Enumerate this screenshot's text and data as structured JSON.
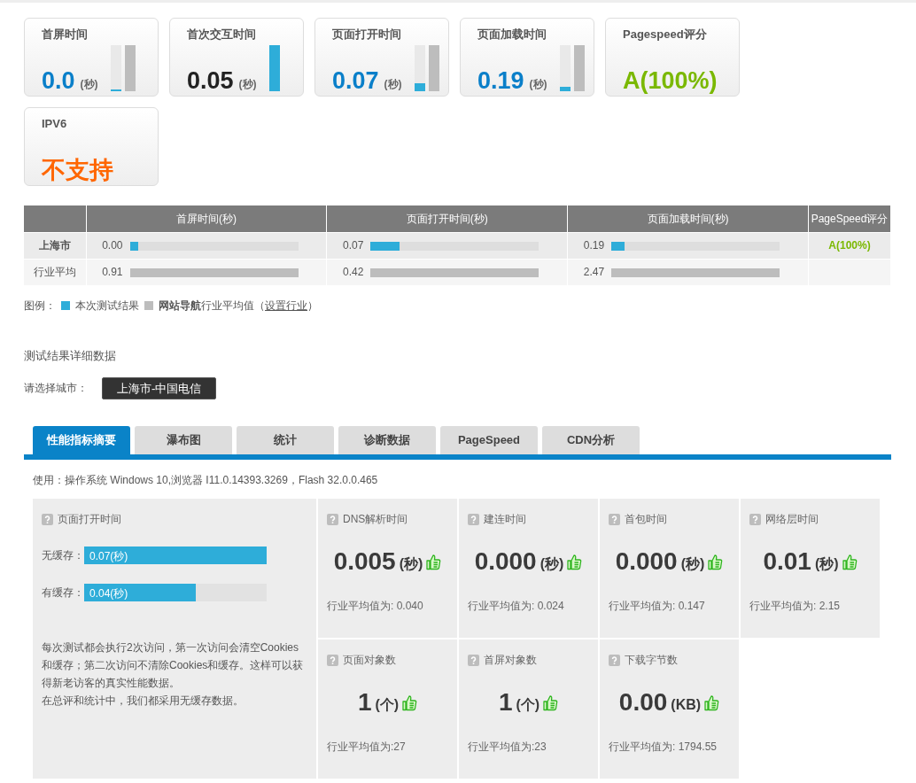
{
  "summary_cards": [
    {
      "title": "首屏时间",
      "value": "0.0",
      "unit": "(秒)",
      "color": "#0a7fc9",
      "bars": [
        {
          "kind": "current",
          "level": 0.03
        },
        {
          "kind": "average",
          "level": 1
        }
      ]
    },
    {
      "title": "首次交互时间",
      "value": "0.05",
      "unit": "(秒)",
      "color": "#222222",
      "bars": [
        {
          "kind": "current",
          "level": 1
        }
      ]
    },
    {
      "title": "页面打开时间",
      "value": "0.07",
      "unit": "(秒)",
      "color": "#0a7fc9",
      "bars": [
        {
          "kind": "current",
          "level": 0.17
        },
        {
          "kind": "average",
          "level": 1
        }
      ]
    },
    {
      "title": "页面加载时间",
      "value": "0.19",
      "unit": "(秒)",
      "color": "#0a7fc9",
      "bars": [
        {
          "kind": "current",
          "level": 0.08
        },
        {
          "kind": "average",
          "level": 1
        }
      ]
    },
    {
      "title": "Pagespeed评分",
      "value": "A(100%)",
      "color": "#7ab800"
    },
    {
      "title": "IPV6",
      "value": "不支持",
      "color": "#ff6600"
    }
  ],
  "comparison_table": {
    "columns": [
      "首屏时间(秒)",
      "页面打开时间(秒)",
      "页面加载时间(秒)",
      "PageSpeed评分"
    ],
    "rows": [
      {
        "kind": "current",
        "label": "上海市",
        "cells": [
          {
            "value": "0.00",
            "level": 0.05
          },
          {
            "value": "0.07",
            "level": 0.17
          },
          {
            "value": "0.19",
            "level": 0.08
          }
        ],
        "score": "A(100%)"
      },
      {
        "kind": "average",
        "label": "行业平均",
        "cells": [
          {
            "value": "0.91",
            "level": 1
          },
          {
            "value": "0.42",
            "level": 1
          },
          {
            "value": "2.47",
            "level": 1
          }
        ]
      }
    ]
  },
  "legend": {
    "label": "图例：",
    "items": [
      {
        "kind": "current",
        "text": "本次测试结果"
      },
      {
        "kind": "average",
        "text": "**网站导航**行业平均值（",
        "link": "设置行业",
        "after": "）"
      }
    ]
  },
  "details_title": "测试结果详细数据",
  "city_label": "请选择城市：",
  "city_button": "上海市-中国电信",
  "tabs": [
    {
      "label": "性能指标摘要",
      "selected": true
    },
    {
      "label": "瀑布图",
      "selected": false
    },
    {
      "label": "统计",
      "selected": false
    },
    {
      "label": "诊断数据",
      "selected": false
    },
    {
      "label": "PageSpeed",
      "selected": false
    },
    {
      "label": "CDN分析",
      "selected": false
    }
  ],
  "environment": "使用：操作系统 Windows 10,浏览器 I11.0.14393.3269，Flash 32.0.0.465",
  "open_time_panel": {
    "title": "页面打开时间",
    "rows": [
      {
        "label": "无缓存：",
        "value": "0.07(秒)",
        "level": 1
      },
      {
        "label": "有缓存：",
        "value": "0.04(秒)",
        "level": 0.61
      }
    ],
    "notes": [
      "每次测试都会执行2次访问，第一次访问会清空Cookies和缓存；第二次访问不清除Cookies和缓存。这样可以获得新老访客的真实性能数据。",
      "在总评和统计中，我们都采用无缓存数据。"
    ]
  },
  "metrics": [
    {
      "title": "DNS解析时间",
      "value": "0.005",
      "unit": "(秒)",
      "average": "行业平均值为: 0.040"
    },
    {
      "title": "建连时间",
      "value": "0.000",
      "unit": "(秒)",
      "average": "行业平均值为: 0.024"
    },
    {
      "title": "首包时间",
      "value": "0.000",
      "unit": "(秒)",
      "average": "行业平均值为: 0.147"
    },
    {
      "title": "网络层时间",
      "value": "0.01",
      "unit": "(秒)",
      "average": "行业平均值为: 2.15"
    },
    {
      "title": "页面对象数",
      "value": "1",
      "unit": "(个)",
      "average": "行业平均值为:27"
    },
    {
      "title": "首屏对象数",
      "value": "1",
      "unit": "(个)",
      "average": "行业平均值为:23"
    },
    {
      "title": "下载字节数",
      "value": "0.00",
      "unit": "(KB)",
      "average": "行业平均值为: 1794.55"
    }
  ]
}
